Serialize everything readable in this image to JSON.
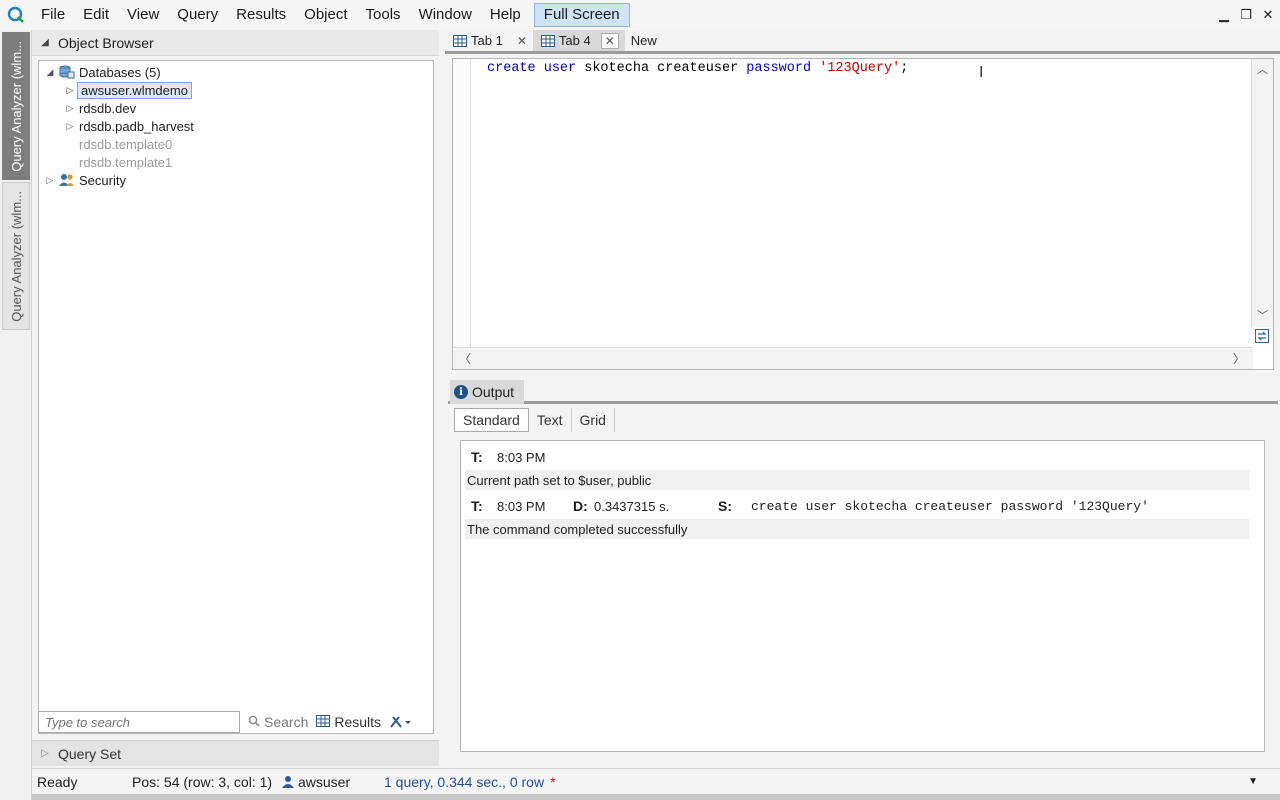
{
  "menu": {
    "items": [
      "File",
      "Edit",
      "View",
      "Query",
      "Results",
      "Object",
      "Tools",
      "Window",
      "Help"
    ],
    "fullscreen": "Full Screen",
    "window_controls": [
      "minimize-icon",
      "restore-icon",
      "close-icon"
    ]
  },
  "side_tabs": {
    "active": "Query Analyzer (wlm...",
    "inactive": "Query Analyzer (wlm..."
  },
  "object_browser": {
    "title": "Object Browser",
    "root": "Databases (5)",
    "databases": [
      {
        "name": "awsuser.wlmdemo",
        "selected": true,
        "expandable": true
      },
      {
        "name": "rdsdb.dev",
        "expandable": true
      },
      {
        "name": "rdsdb.padb_harvest",
        "expandable": true
      },
      {
        "name": "rdsdb.template0",
        "dim": true
      },
      {
        "name": "rdsdb.template1",
        "dim": true
      }
    ],
    "security": "Security",
    "search_placeholder": "Type to search",
    "search_button": "Search",
    "results_button": "Results"
  },
  "query_set": {
    "title": "Query Set"
  },
  "tabs": [
    {
      "label": "Tab 1",
      "active": false
    },
    {
      "label": "Tab 4",
      "active": true
    },
    {
      "label": "New"
    }
  ],
  "editor": {
    "tokens": {
      "t1": "create",
      "t2": "user",
      "t3": "skotecha",
      "t4": "createuser",
      "t5": "password",
      "t6": "'123Query'",
      "t7": ";"
    }
  },
  "output": {
    "title": "Output",
    "subtabs": [
      "Standard",
      "Text",
      "Grid"
    ],
    "rows": {
      "r1_t_label": "T:",
      "r1_time": "8:03 PM",
      "r2_msg": "Current path set to $user, public",
      "r3_t_label": "T:",
      "r3_time": "8:03 PM",
      "r3_d_label": "D:",
      "r3_duration": "0.3437315 s.",
      "r3_s_label": "S:",
      "r3_stmt": "create user skotecha createuser password '123Query'",
      "r4_msg": "The command completed successfully"
    }
  },
  "status": {
    "ready": "Ready",
    "pos": "Pos: 54 (row: 3, col: 1)",
    "user": "awsuser",
    "query_info": "1 query, 0.344 sec., 0 row",
    "modified": "*"
  }
}
